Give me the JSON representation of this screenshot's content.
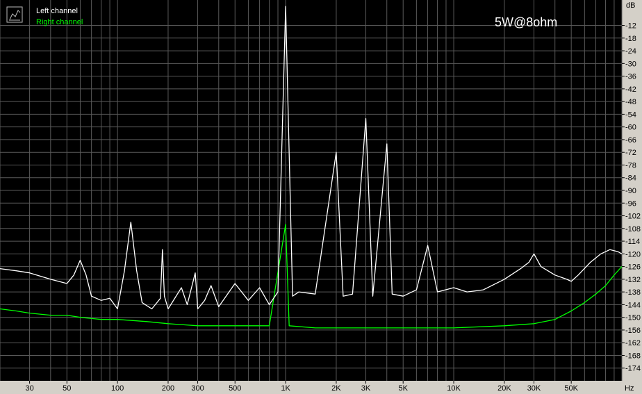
{
  "chart_data": {
    "type": "line",
    "title": "",
    "annotation": "5W@8ohm",
    "xlabel": "Hz",
    "ylabel": "dB",
    "xscale": "log",
    "xlim": [
      20,
      100000
    ],
    "ylim": [
      -180,
      0
    ],
    "grid": true,
    "legend_position": "top-left",
    "x_ticks": [
      {
        "v": 30,
        "label": "30"
      },
      {
        "v": 50,
        "label": "50"
      },
      {
        "v": 100,
        "label": "100"
      },
      {
        "v": 200,
        "label": "200"
      },
      {
        "v": 300,
        "label": "300"
      },
      {
        "v": 500,
        "label": "500"
      },
      {
        "v": 1000,
        "label": "1K"
      },
      {
        "v": 2000,
        "label": "2K"
      },
      {
        "v": 3000,
        "label": "3K"
      },
      {
        "v": 5000,
        "label": "5K"
      },
      {
        "v": 10000,
        "label": "10K"
      },
      {
        "v": 20000,
        "label": "20K"
      },
      {
        "v": 30000,
        "label": "30K"
      },
      {
        "v": 50000,
        "label": "50K"
      }
    ],
    "y_ticks": [
      -12,
      -18,
      -24,
      -30,
      -36,
      -42,
      -48,
      -54,
      -60,
      -66,
      -72,
      -78,
      -84,
      -90,
      -96,
      -102,
      -108,
      -114,
      -120,
      -126,
      -132,
      -138,
      -144,
      -150,
      -156,
      -162,
      -168,
      -174
    ],
    "series": [
      {
        "name": "Left channel",
        "color": "#ffffff",
        "points": [
          [
            20,
            -127
          ],
          [
            25,
            -128
          ],
          [
            30,
            -129
          ],
          [
            40,
            -132
          ],
          [
            50,
            -134
          ],
          [
            55,
            -130
          ],
          [
            60,
            -123
          ],
          [
            65,
            -130
          ],
          [
            70,
            -140
          ],
          [
            80,
            -142
          ],
          [
            90,
            -141
          ],
          [
            100,
            -146
          ],
          [
            110,
            -128
          ],
          [
            120,
            -105
          ],
          [
            130,
            -128
          ],
          [
            140,
            -143
          ],
          [
            160,
            -146
          ],
          [
            180,
            -141
          ],
          [
            185,
            -118
          ],
          [
            190,
            -140
          ],
          [
            200,
            -146
          ],
          [
            240,
            -136
          ],
          [
            260,
            -144
          ],
          [
            290,
            -129
          ],
          [
            300,
            -146
          ],
          [
            330,
            -142
          ],
          [
            360,
            -135
          ],
          [
            400,
            -145
          ],
          [
            500,
            -134
          ],
          [
            600,
            -142
          ],
          [
            700,
            -136
          ],
          [
            800,
            -144
          ],
          [
            900,
            -138
          ],
          [
            1000,
            -3
          ],
          [
            1100,
            -140
          ],
          [
            1200,
            -138
          ],
          [
            1500,
            -139
          ],
          [
            2000,
            -72
          ],
          [
            2200,
            -140
          ],
          [
            2500,
            -139
          ],
          [
            3000,
            -56
          ],
          [
            3300,
            -140
          ],
          [
            4000,
            -68
          ],
          [
            4300,
            -139
          ],
          [
            5000,
            -140
          ],
          [
            6000,
            -137
          ],
          [
            7000,
            -116
          ],
          [
            8000,
            -138
          ],
          [
            10000,
            -136
          ],
          [
            12000,
            -138
          ],
          [
            15000,
            -137
          ],
          [
            20000,
            -132
          ],
          [
            25000,
            -127
          ],
          [
            28000,
            -124
          ],
          [
            30000,
            -120
          ],
          [
            33000,
            -126
          ],
          [
            40000,
            -130
          ],
          [
            47000,
            -132
          ],
          [
            50000,
            -133
          ],
          [
            55000,
            -130
          ],
          [
            65000,
            -124
          ],
          [
            75000,
            -120
          ],
          [
            85000,
            -118
          ],
          [
            95000,
            -119
          ],
          [
            100000,
            -120
          ]
        ]
      },
      {
        "name": "Right channel",
        "color": "#00ff00",
        "points": [
          [
            20,
            -146
          ],
          [
            25,
            -147
          ],
          [
            30,
            -148
          ],
          [
            40,
            -149
          ],
          [
            50,
            -149
          ],
          [
            60,
            -150
          ],
          [
            80,
            -151
          ],
          [
            100,
            -151
          ],
          [
            150,
            -152
          ],
          [
            200,
            -153
          ],
          [
            300,
            -154
          ],
          [
            500,
            -154
          ],
          [
            800,
            -154
          ],
          [
            1000,
            -106
          ],
          [
            1050,
            -154
          ],
          [
            1500,
            -155
          ],
          [
            2000,
            -155
          ],
          [
            3000,
            -155
          ],
          [
            5000,
            -155
          ],
          [
            10000,
            -155
          ],
          [
            20000,
            -154
          ],
          [
            30000,
            -153
          ],
          [
            40000,
            -151
          ],
          [
            50000,
            -147
          ],
          [
            60000,
            -143
          ],
          [
            70000,
            -139
          ],
          [
            80000,
            -135
          ],
          [
            90000,
            -130
          ],
          [
            100000,
            -126
          ]
        ]
      }
    ]
  }
}
